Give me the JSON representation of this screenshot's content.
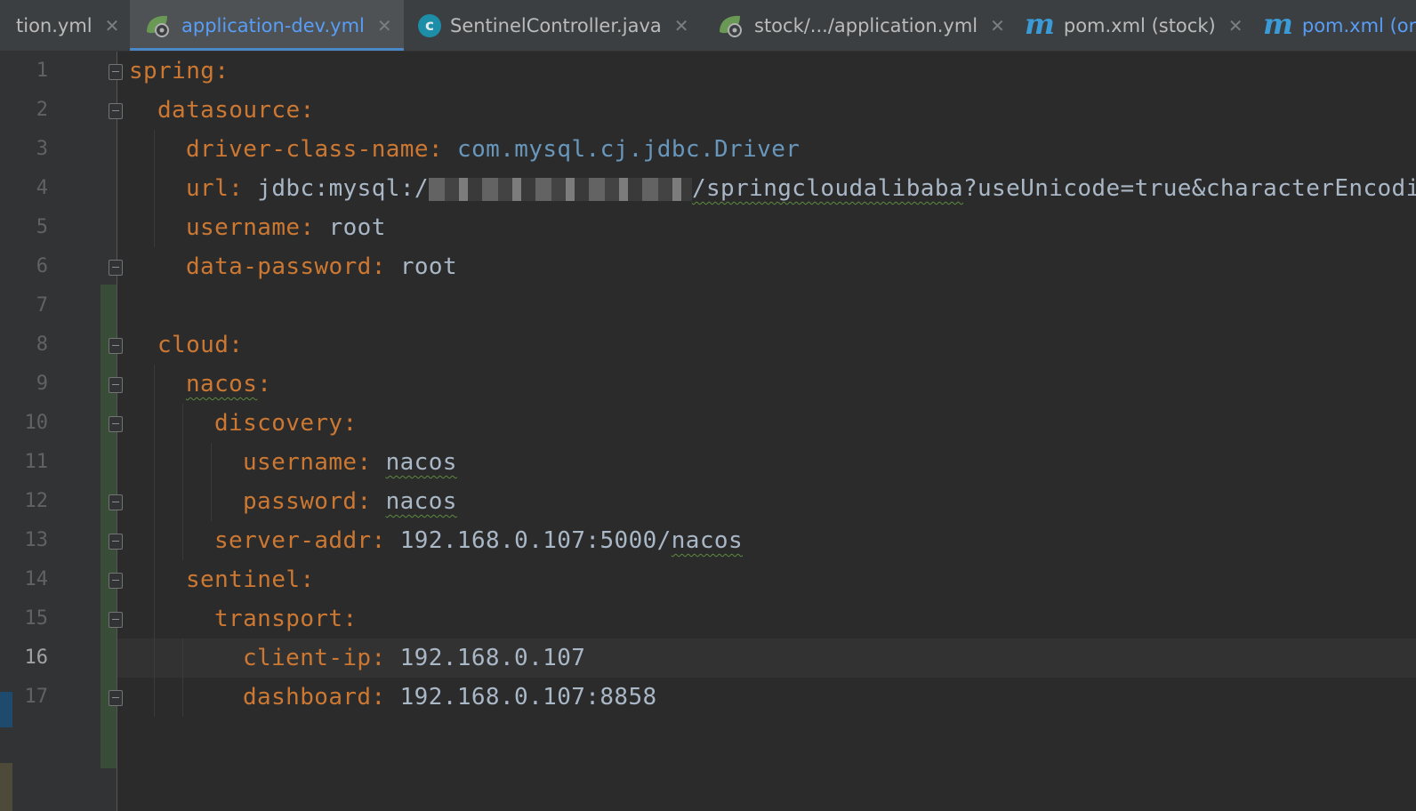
{
  "tabs": [
    {
      "label": "tion.yml",
      "icon": "spring-yaml-icon",
      "active": false
    },
    {
      "label": "application-dev.yml",
      "icon": "spring-yaml-icon",
      "active": true
    },
    {
      "label": "SentinelController.java",
      "icon": "java-class-icon",
      "active": false
    },
    {
      "label": "stock/.../application.yml",
      "icon": "spring-yaml-icon",
      "active": false
    },
    {
      "label": "pom.xml (stock)",
      "icon": "maven-icon",
      "active": false
    },
    {
      "label": "pom.xml (ord",
      "icon": "maven-icon",
      "active": false
    }
  ],
  "editor": {
    "current_line": 16,
    "lines": [
      {
        "num": "1",
        "key": "spring",
        "colon": ":",
        "value": ""
      },
      {
        "num": "2",
        "key": "datasource",
        "colon": ":",
        "value": ""
      },
      {
        "num": "3",
        "key": "driver-class-name",
        "colon": ":",
        "value": "com.mysql.cj.jdbc.Driver"
      },
      {
        "num": "4",
        "key": "url",
        "colon": ":",
        "value_prefix": "jdbc:mysql:/",
        "value_suffix_a": "/springcloudalibaba",
        "value_suffix_b": "?useUnicode=true&characterEncodi"
      },
      {
        "num": "5",
        "key": "username",
        "colon": ":",
        "value": "root"
      },
      {
        "num": "6",
        "key": "data-password",
        "colon": ":",
        "value": "root"
      },
      {
        "num": "7",
        "key": "",
        "colon": "",
        "value": ""
      },
      {
        "num": "8",
        "key": "cloud",
        "colon": ":",
        "value": ""
      },
      {
        "num": "9",
        "key": "nacos",
        "colon": ":",
        "value": ""
      },
      {
        "num": "10",
        "key": "discovery",
        "colon": ":",
        "value": ""
      },
      {
        "num": "11",
        "key": "username",
        "colon": ":",
        "value": "nacos"
      },
      {
        "num": "12",
        "key": "password",
        "colon": ":",
        "value": "nacos"
      },
      {
        "num": "13",
        "key": "server-addr",
        "colon": ":",
        "value_prefix": "192.168.0.107:5000/",
        "value_suffix_a": "nacos"
      },
      {
        "num": "14",
        "key": "sentinel",
        "colon": ":",
        "value": ""
      },
      {
        "num": "15",
        "key": "transport",
        "colon": ":",
        "value": ""
      },
      {
        "num": "16",
        "key": "client-ip",
        "colon": ":",
        "value": "192.168.0.107"
      },
      {
        "num": "17",
        "key": "dashboard",
        "colon": ":",
        "value": "192.168.0.107:8858"
      }
    ]
  },
  "colors": {
    "keyword": "#cc7832",
    "plain": "#a9b7c6",
    "constant": "#6897bb",
    "active_tab_text": "#589df6",
    "background": "#2b2b2b",
    "gutter": "#313335"
  }
}
